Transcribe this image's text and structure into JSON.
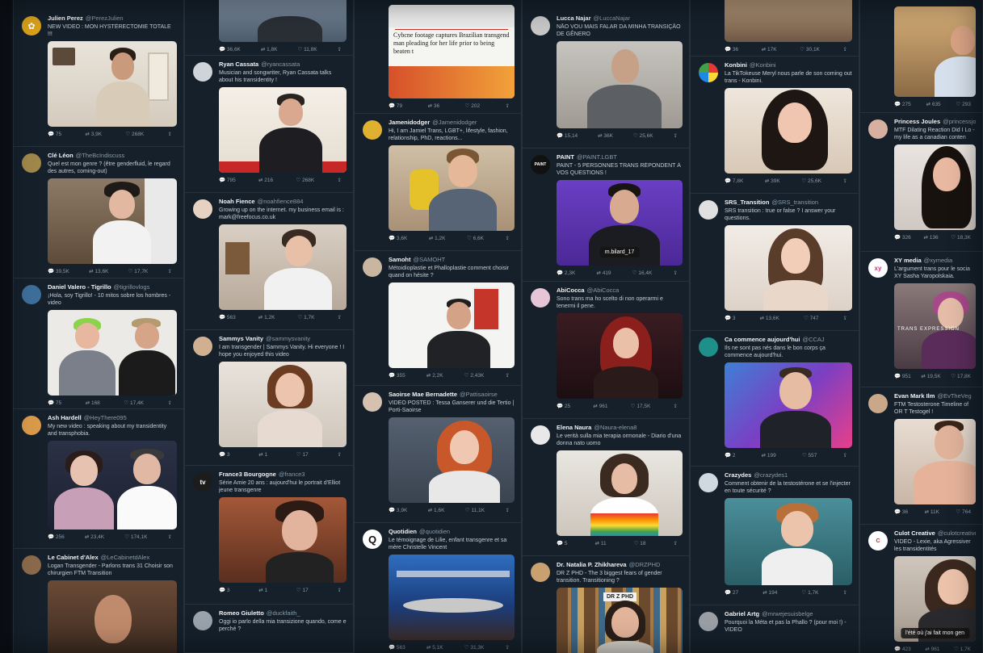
{
  "columns": [
    {
      "tweets": [
        {
          "name": "Julien Perez",
          "handle": "@PerezJulien",
          "text": "NEW VIDEO : MON HYSTÉRECTOMIE TOTALE !!!",
          "replies": "75",
          "retweets": "3,9K",
          "likes": "268K",
          "avatar_color": "#d9a21a",
          "avatar_icon": "sunflower-icon"
        },
        {
          "name": "Clé Léon",
          "handle": "@TheBcIndiscuss",
          "text": "Quel est mon genre ? (être genderfluid, le regard des autres, coming-out)",
          "replies": "39,5K",
          "retweets": "13,6K",
          "likes": "17,7K",
          "avatar_color": "#a0874a",
          "avatar_icon": "profile-photo-icon"
        },
        {
          "name": "Daniel Valero - Tigrillo",
          "handle": "@tigrillovlogs",
          "text": "¡Hola, soy Tigrillo! - 10 mitos sobre los hombres - video",
          "replies": "75",
          "retweets": "168",
          "likes": "17,4K",
          "avatar_color": "#3e6f9a",
          "avatar_icon": "profile-photo-icon"
        },
        {
          "name": "Ash Hardell",
          "handle": "@HeyThere095",
          "text": "My new video : speaking about my transidentity and transphobia.",
          "replies": "256",
          "retweets": "23,4K",
          "likes": "174,1K",
          "avatar_color": "#d99a4a",
          "avatar_icon": "profile-photo-icon"
        },
        {
          "name": "Le Cabinet d'Alex",
          "handle": "@LeCabinetdAlex",
          "text": "Logan Transgender - Parlons trans 31 Choisir son chirurgien FTM Transition",
          "replies": "",
          "retweets": "",
          "likes": "",
          "avatar_color": "#8a6a4a",
          "avatar_icon": "profile-photo-icon"
        }
      ]
    },
    {
      "tweets": [
        {
          "name": "",
          "handle": "",
          "text": "",
          "replies": "36,6K",
          "retweets": "1,8K",
          "likes": "11,8K",
          "avatar_color": "",
          "avatar_icon": ""
        },
        {
          "name": "Ryan Cassata",
          "handle": "@ryancassata",
          "text": "Musician and songwriter, Ryan Cassata talks about his transidentity !",
          "replies": "795",
          "retweets": "216",
          "likes": "268K",
          "avatar_color": "#cfd4d8",
          "avatar_icon": "profile-photo-icon"
        },
        {
          "name": "Noah Fience",
          "handle": "@noahfience884",
          "text": "Growing up on the internet. my business email is : mark@freefocus.co.uk",
          "replies": "563",
          "retweets": "1,2K",
          "likes": "1,7K",
          "avatar_color": "#e6d2c2",
          "avatar_icon": "profile-photo-icon"
        },
        {
          "name": "Sammys Vanity",
          "handle": "@sammysvanity",
          "text": "I am transgender | Sammys Vanity. Hi everyone ! I hope you enjoyed this video",
          "replies": "3",
          "retweets": "1",
          "likes": "17",
          "avatar_color": "#d0b090",
          "avatar_icon": "profile-photo-icon"
        },
        {
          "name": "France3 Bourgogne",
          "handle": "@france3",
          "text": "Série Amie 20 ans : aujourd'hui le portrait d'Elliot jeune transgenre",
          "replies": "3",
          "retweets": "1",
          "likes": "17",
          "avatar_color": "#1c1c1c",
          "avatar_icon": "tv-logo-icon"
        },
        {
          "name": "Romeo Giuletto",
          "handle": "@duckfaith_",
          "text": "Oggi io parlo della mia transizione quando, come e perché ?",
          "replies": "",
          "retweets": "",
          "likes": "",
          "avatar_color": "#9aa3ab",
          "avatar_icon": "profile-photo-icon"
        }
      ]
    },
    {
      "tweets": [
        {
          "name": "",
          "handle": "",
          "text": "",
          "replies": "79",
          "retweets": "36",
          "likes": "202",
          "avatar_color": "",
          "avatar_icon": "",
          "headline": "Cybcne footage captures Brazilian transgend man pleading for her life prior to being beaten t"
        },
        {
          "name": "Jamenidodger",
          "handle": "@Jamenidodger",
          "text": "Hi, I am Jamiel Trans, LGBT+, lifestyle, fashion, relationship, PhD, reactions...",
          "replies": "3,6K",
          "retweets": "1,2K",
          "likes": "6,6K",
          "avatar_color": "#e0b030",
          "avatar_icon": "profile-photo-icon"
        },
        {
          "name": "Samoht",
          "handle": "@SAMOHT",
          "text": "Métoidioplastie et Phalloplastie comment choisir quand on hésite ?",
          "replies": "355",
          "retweets": "2,2K",
          "likes": "2,43K",
          "avatar_color": "#c9b6a0",
          "avatar_icon": "profile-photo-icon"
        },
        {
          "name": "Saoirse Mae Bernadette",
          "handle": "@Pattisaoirse",
          "text": "VIDEO POSTED : Tessa Ganserer und die Tertio | Porti-Saoirse",
          "replies": "3,9K",
          "retweets": "1,6K",
          "likes": "11,1K",
          "avatar_color": "#d6c0b0",
          "avatar_icon": "profile-photo-icon"
        },
        {
          "name": "Quotidien",
          "handle": "@quotidien",
          "text": "Le témoignage de Lilie, enfant transgenre et sa mère Christelle Vincent",
          "replies": "563",
          "retweets": "5,1K",
          "likes": "31,3K",
          "avatar_color": "#ffffff",
          "avatar_icon": "q-logo-icon"
        }
      ]
    },
    {
      "tweets": [
        {
          "name": "Lucca Najar",
          "handle": "@LuccaNajar",
          "text": "NÃO VOU MAIS FALAR DA MINHA TRANSIÇÃO DE GÊNERO",
          "replies": "15,14",
          "retweets": "36K",
          "likes": "25,6K",
          "avatar_color": "#c8c8c8",
          "avatar_icon": "profile-photo-icon"
        },
        {
          "name": "PAINT",
          "handle": "@PAINT.LGBT",
          "text": "PAINT - 5 PERSONNES TRANS RÉPONDENT À VOS QUESTIONS !",
          "replies": "2,3K",
          "retweets": "419",
          "likes": "16,4K",
          "avatar_color": "#111111",
          "avatar_icon": "paint-logo-icon",
          "caption": "m.bilard_17"
        },
        {
          "name": "AbiCocca",
          "handle": "@AbiCocca",
          "text": "Sono trans ma ho scelto di non operarmi e tenermi il pene.",
          "replies": "25",
          "retweets": "961",
          "likes": "17,5K",
          "avatar_color": "#e6c6d6",
          "avatar_icon": "profile-photo-icon"
        },
        {
          "name": "Elena Naura",
          "handle": "@Naura-elena8",
          "text": "Le verità sulla mia terapia ormonale - Diario d'una donna nato uomo",
          "replies": "5",
          "retweets": "11",
          "likes": "18",
          "avatar_color": "#e8e8e8",
          "avatar_icon": "profile-photo-icon"
        },
        {
          "name": "Dr. Natalia P. Zhikhareva",
          "handle": "@DRZPHD",
          "text": "DR Z PHD - The 3 biggest fears of gender transition. Transitioning ?",
          "replies": "",
          "retweets": "",
          "likes": "",
          "avatar_color": "#c9a070",
          "avatar_icon": "profile-photo-icon",
          "sign": "DR Z PHD"
        }
      ]
    },
    {
      "tweets": [
        {
          "name": "",
          "handle": "",
          "text": "",
          "replies": "36",
          "retweets": "17K",
          "likes": "30,1K",
          "avatar_color": "",
          "avatar_icon": ""
        },
        {
          "name": "Konbini",
          "handle": "@Konbini",
          "text": "La TikTokeuse Meryl nous parle de son coming out trans - Konbini.",
          "replies": "7,8K",
          "retweets": "39K",
          "likes": "25,6K",
          "avatar_color": "#f5f5f5",
          "avatar_icon": "konbini-logo-icon"
        },
        {
          "name": "SRS_Transition",
          "handle": "@SRS_transition",
          "text": "SRS transition : true or false ? I answer your questions.",
          "replies": "3",
          "retweets": "13,6K",
          "likes": "747",
          "avatar_color": "#e0e0e0",
          "avatar_icon": "profile-photo-icon"
        },
        {
          "name": "Ca commence aujourd'hui",
          "handle": "@CCAJ",
          "text": "Ils ne sont pas nés dans le bon corps ça commence aujourd'hui.",
          "replies": "2",
          "retweets": "199",
          "likes": "557",
          "avatar_color": "#1f8f8a",
          "avatar_icon": "profile-photo-icon"
        },
        {
          "name": "Crazydes",
          "handle": "@crazydes1",
          "text": "Comment obtenir de la testostérone et se l'injecter en toute sécurité ?",
          "replies": "27",
          "retweets": "194",
          "likes": "1,7K",
          "avatar_color": "#d0d8e0",
          "avatar_icon": "profile-photo-icon"
        },
        {
          "name": "Gabriel Artg",
          "handle": "@mrwejesuisbelge",
          "text": "Pourquoi la Méta et pas la Phallo ? (pour moi !) - VIDEO",
          "replies": "",
          "retweets": "",
          "likes": "",
          "avatar_color": "#9aa0a6",
          "avatar_icon": "profile-photo-icon"
        }
      ]
    },
    {
      "tweets": [
        {
          "name": "",
          "handle": "",
          "text": "",
          "replies": "275",
          "retweets": "635",
          "likes": "293",
          "avatar_color": "",
          "avatar_icon": ""
        },
        {
          "name": "Princess Joules",
          "handle": "@princessjoules",
          "text": "MTF Dilating Reaction Did I Lo - my life as a canadian conten",
          "replies": "326",
          "retweets": "136",
          "likes": "18,3K",
          "avatar_color": "#d8b0a0",
          "avatar_icon": "profile-photo-icon"
        },
        {
          "name": "XY media",
          "handle": "@xymedia",
          "text": "L'argument trans pour le socia XY Sasha Yaropolskaia.",
          "replies": "951",
          "retweets": "19,5K",
          "likes": "17,8K",
          "avatar_color": "#ffffff",
          "avatar_icon": "xy-logo-icon",
          "overlay": "TRANS EXPRESSION"
        },
        {
          "name": "Evan Mark Ilm",
          "handle": "@EvTheVeg",
          "text": "FTM Testosterone Timeline of OR T Testogel !",
          "replies": "36",
          "retweets": "11K",
          "likes": "764",
          "avatar_color": "#c9a88a",
          "avatar_icon": "profile-photo-icon"
        },
        {
          "name": "Culot Creative",
          "handle": "@culotcreative",
          "text": "VIDEO - Lexie, aka Agressiver les transidentités",
          "replies": "423",
          "retweets": "961",
          "likes": "1,7K",
          "avatar_color": "#ffffff",
          "avatar_icon": "culot-logo-icon",
          "caption": "l'été où j'ai fait mon gen"
        }
      ]
    }
  ],
  "colors": {
    "column_bg": "#15202b",
    "border": "#26323d",
    "name": "#f0f3f5",
    "handle": "#8899a6"
  }
}
